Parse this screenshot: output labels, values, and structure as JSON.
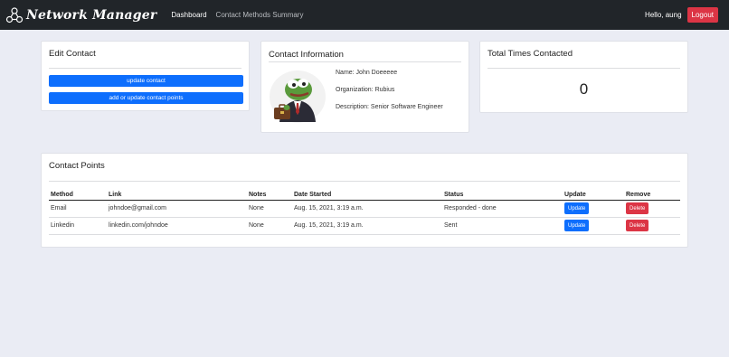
{
  "navbar": {
    "brand": "Network Manager",
    "links": [
      "Dashboard",
      "Contact Methods Summary"
    ],
    "greeting": "Hello, aung",
    "logout_label": "Logout"
  },
  "edit_contact": {
    "title": "Edit Contact",
    "update_contact_label": "update contact",
    "contact_points_label": "add or update contact points"
  },
  "contact_info": {
    "title": "Contact Information",
    "name": "Name: John Doeeeee",
    "organization": "Organization: Rubius",
    "description": "Description: Senior Software Engineer"
  },
  "times_contacted": {
    "title": "Total Times Contacted",
    "count": "0"
  },
  "contact_points": {
    "title": "Contact Points",
    "columns": [
      "Method",
      "Link",
      "Notes",
      "Date Started",
      "Status",
      "Update",
      "Remove"
    ],
    "rows": [
      {
        "method": "Email",
        "link": "johndoe@gmail.com",
        "notes": "None",
        "date_started": "Aug. 15, 2021, 3:19 a.m.",
        "status": "Responded - done",
        "update_label": "Update",
        "remove_label": "Delete"
      },
      {
        "method": "Linkedin",
        "link": "linkedin.com/johndoe",
        "notes": "None",
        "date_started": "Aug. 15, 2021, 3:19 a.m.",
        "status": "Sent",
        "update_label": "Update",
        "remove_label": "Delete"
      }
    ]
  },
  "colors": {
    "navbar_bg": "#212529",
    "page_bg": "#eaecf4",
    "primary": "#0d6efd",
    "danger": "#dc3545"
  }
}
